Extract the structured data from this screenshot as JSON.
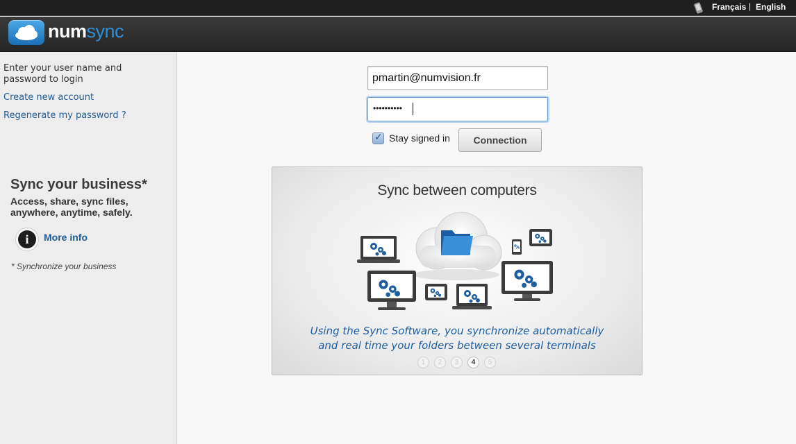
{
  "language_bar": {
    "icon": "mobile-phone-icon",
    "french_label": "Français",
    "separator": "|",
    "english_label": "English"
  },
  "header": {
    "logo_icon": "cloud-icon",
    "logo_num": "num",
    "logo_sync": "sync",
    "brand_color": "#2f8fd8"
  },
  "sidebar": {
    "intro_text": "Enter your user name and password to login",
    "create_account_link": "Create new account",
    "regenerate_password_link": "Regenerate my password ?",
    "promo_title": "Sync your business*",
    "promo_subtitle": "Access, share, sync files, anywhere, anytime, safely.",
    "info_icon": "info-icon",
    "info_icon_glyph": "i",
    "more_info_link": "More info",
    "footnote": "* Synchronize your business"
  },
  "login": {
    "username_value": "pmartin@numvision.fr",
    "password_masked": "••••••••••",
    "stay_signed_in_label": "Stay signed in",
    "stay_signed_in_checked": true,
    "connection_button": "Connection"
  },
  "slideshow": {
    "title": "Sync between computers",
    "caption": "Using the Sync Software, you synchronize automatically and real time your folders between several terminals",
    "pages": [
      "1",
      "2",
      "3",
      "4",
      "5"
    ],
    "active_page": "4",
    "accent_color": "#1f5fa0"
  }
}
